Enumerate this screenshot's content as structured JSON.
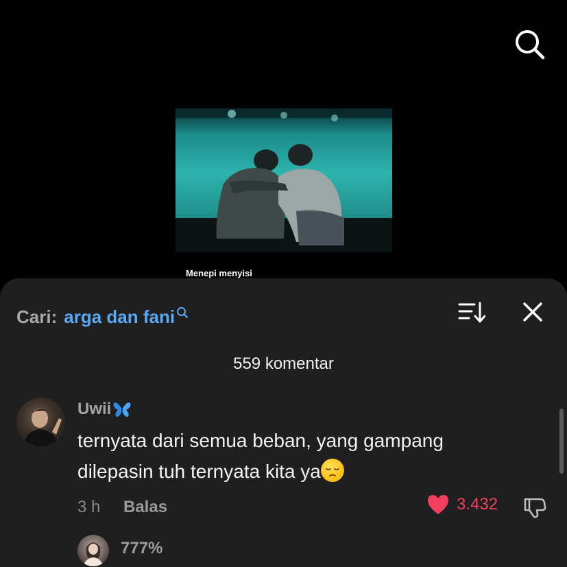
{
  "video": {
    "caption": "Menepi menyisi",
    "search_icon": "search-icon"
  },
  "comments_panel": {
    "search_prefix": "Cari:",
    "search_term": "arga dan fani",
    "comment_count": "559 komentar",
    "sort_icon": "sort-icon",
    "close_icon": "close-icon",
    "comments": [
      {
        "username": "Uwii",
        "username_emoji": "butterfly-icon",
        "text": "ternyata dari semua beban, yang gampang dilepasin tuh ternyata kita ya",
        "text_emoji": "pensive-face-emoji",
        "time": "3 h",
        "reply_label": "Balas",
        "likes": "3.432",
        "like_color": "#f0405d"
      }
    ],
    "reply_preview": {
      "text": "777%"
    }
  },
  "colors": {
    "sheet_bg": "#1f1f1f",
    "accent_blue": "#5aa9f6",
    "like_red": "#f0405d"
  }
}
